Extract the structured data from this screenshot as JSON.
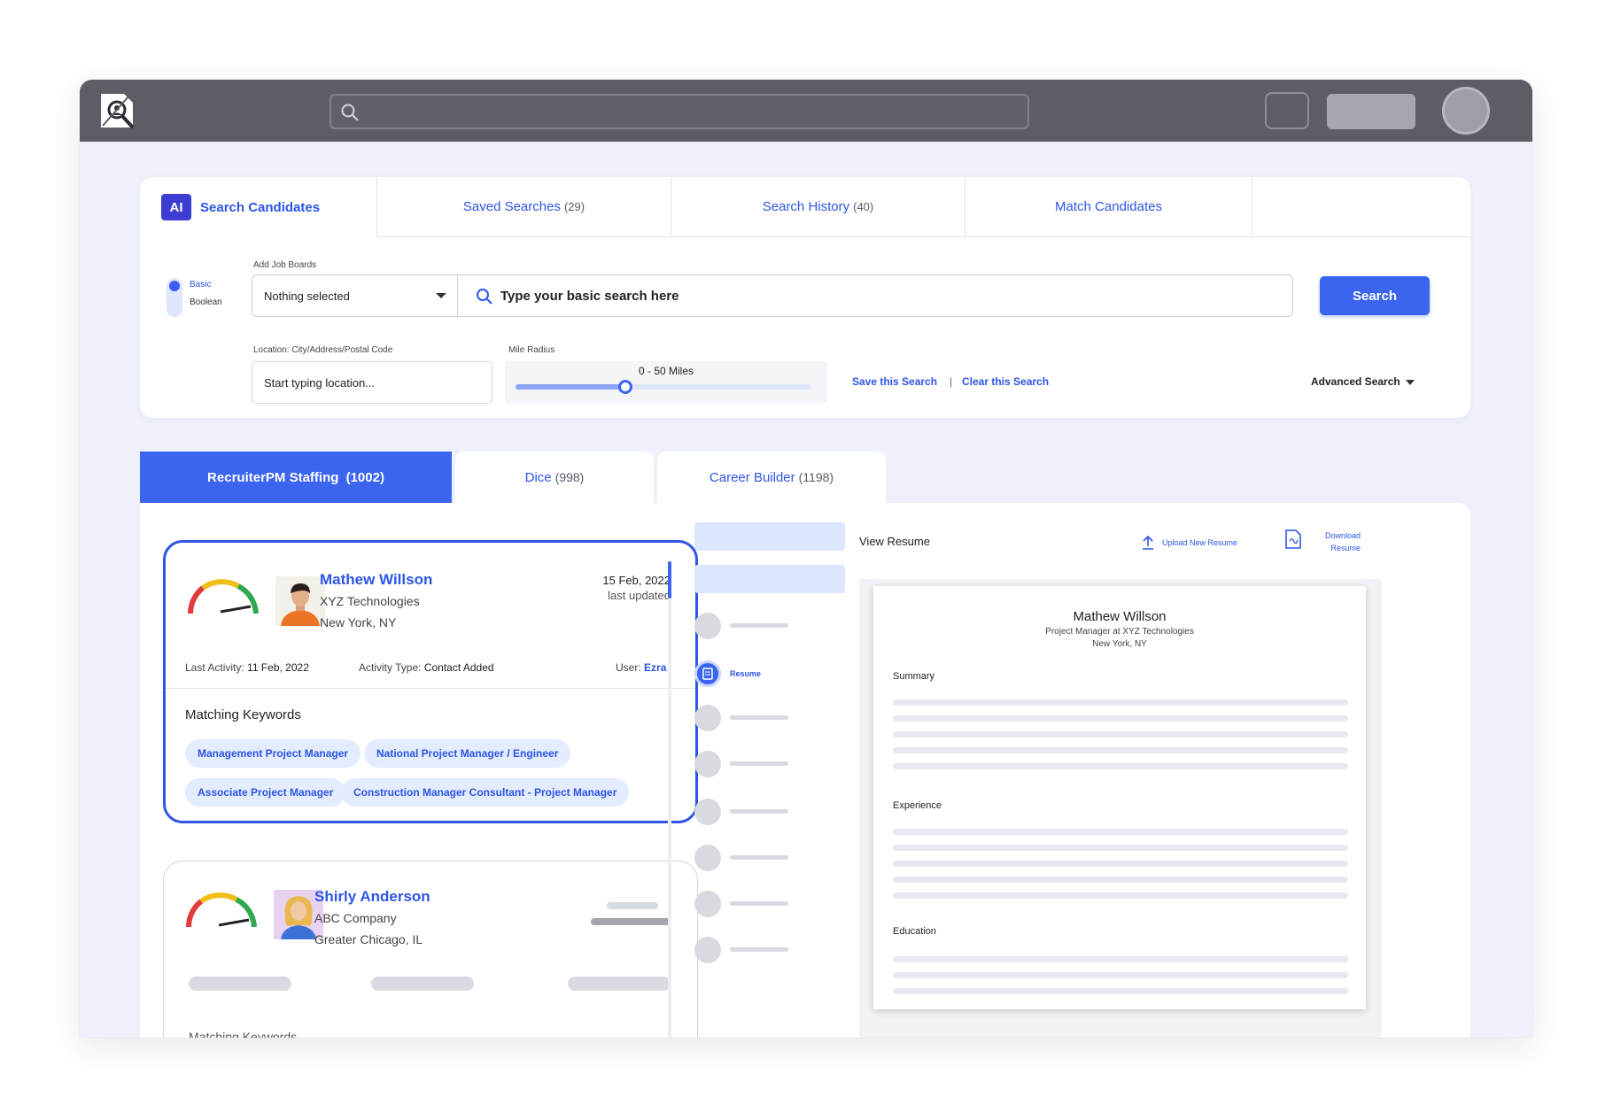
{
  "colors": {
    "accent": "#3b64ef",
    "link": "#2d55e6",
    "topbar": "#5d5e65",
    "page_bg": "#eef1fb",
    "chip_bg": "#e4ecff"
  },
  "topbar": {
    "logo_icon": "logo-icon",
    "search_icon": "search-icon"
  },
  "search_tabs": [
    {
      "label": "Search Candidates",
      "badge": "AI"
    },
    {
      "label": "Saved Searches",
      "count": "(29)"
    },
    {
      "label": "Search History",
      "count": "(40)"
    },
    {
      "label": "Match Candidates"
    }
  ],
  "search": {
    "mode_basic": "Basic",
    "mode_boolean": "Boolean",
    "job_boards_label": "Add Job Boards",
    "job_boards_value": "Nothing selected",
    "query_placeholder": "Type your basic search here",
    "search_button": "Search",
    "location_label": "Location: City/Address/Postal Code",
    "location_placeholder": "Start typing location...",
    "radius_label": "Mile Radius",
    "radius_value": "0 - 50 Miles",
    "radius_fraction": 0.37,
    "save_link": "Save this Search",
    "separator": "|",
    "clear_link": "Clear this Search",
    "advanced": "Advanced Search"
  },
  "board_tabs": [
    {
      "label": "RecruiterPM Staffing",
      "count": "(1002)"
    },
    {
      "label": "Dice",
      "count": "(998)"
    },
    {
      "label": "Career Builder",
      "count": "(1198)"
    }
  ],
  "candidates": [
    {
      "name": "Mathew Willson",
      "company": "XYZ Technologies",
      "location": "New York, NY",
      "date": "15 Feb, 2022",
      "date_sub": "last updated",
      "last_activity_label": "Last Activity:",
      "last_activity": "11  Feb, 2022",
      "activity_type_label": "Activity Type:",
      "activity_type": "Contact Added",
      "user_label": "User:",
      "user": "Ezra",
      "keywords_title": "Matching Keywords",
      "keywords": [
        "Management Project Manager",
        "National Project Manager / Engineer",
        "Associate Project Manager",
        "Construction Manager Consultant - Project Manager"
      ]
    },
    {
      "name": "Shirly Anderson",
      "company": "ABC Company",
      "location": "Greater Chicago, IL",
      "keywords_title": "Matching Keywords"
    }
  ],
  "timeline": {
    "active_label": "Resume"
  },
  "resume_panel": {
    "title": "View Resume",
    "upload": "Upload New Resume",
    "download_line1": "Download",
    "download_line2": "Resume",
    "doc_name": "Mathew Willson",
    "doc_title": "Project Manager at XYZ Technologies",
    "doc_location": "New York, NY",
    "sections": [
      "Summary",
      "Experience",
      "Education"
    ]
  }
}
